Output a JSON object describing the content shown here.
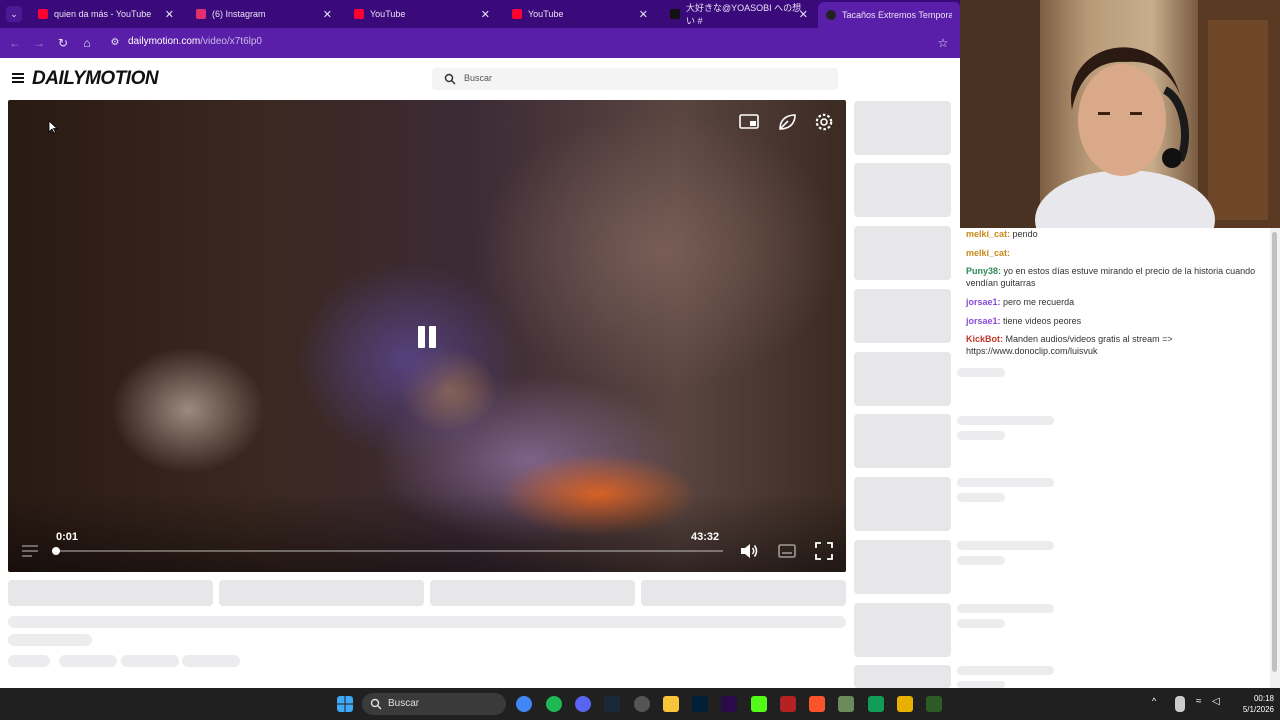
{
  "browser": {
    "tabs": [
      {
        "title": "quien da más - YouTube",
        "favicon": "youtube-icon",
        "color": "#ff0033"
      },
      {
        "title": "(6) Instagram",
        "favicon": "instagram-icon",
        "color": "#e1306c"
      },
      {
        "title": "YouTube",
        "favicon": "youtube-icon",
        "color": "#ff0033"
      },
      {
        "title": "YouTube",
        "favicon": "youtube-icon",
        "color": "#ff0033"
      },
      {
        "title": "大好きな@YOASOBI への想い #",
        "favicon": "tiktok-icon",
        "color": "#111111"
      },
      {
        "title": "Tacaños Extremos Tempora",
        "favicon": "dailymotion-icon",
        "color": "#111111"
      }
    ],
    "active_tab_index": 5,
    "url_domain": "dailymotion.com",
    "url_path": "/video/x7t6lp0",
    "accent_color": "#5a1fa8"
  },
  "site": {
    "logo": "DAILYMOTION",
    "search_placeholder": "Buscar"
  },
  "player": {
    "current_time": "0:01",
    "duration": "43:32",
    "progress_fraction": 0.0004,
    "state": "playing"
  },
  "chat": [
    {
      "user": "melki_cat:",
      "text": "pendo",
      "color": "#c98a1a"
    },
    {
      "user": "melki_cat:",
      "text": "",
      "color": "#c98a1a"
    },
    {
      "user": "Puny38:",
      "text": "yo en estos días estuve mirando el precio de la historia  cuando vendían guitarras",
      "color": "#2e8b57"
    },
    {
      "user": "jorsae1:",
      "text": "pero me recuerda",
      "color": "#8a4bd8"
    },
    {
      "user": "jorsae1:",
      "text": "tiene videos peores",
      "color": "#8a4bd8"
    },
    {
      "user": "KickBot:",
      "text": "Manden audios/videos gratis al stream => https://www.donoclip.com/luisvuk",
      "color": "#c0392b"
    }
  ],
  "taskbar": {
    "search_placeholder": "Buscar",
    "time": "00:18",
    "date": "5/1/2026"
  }
}
